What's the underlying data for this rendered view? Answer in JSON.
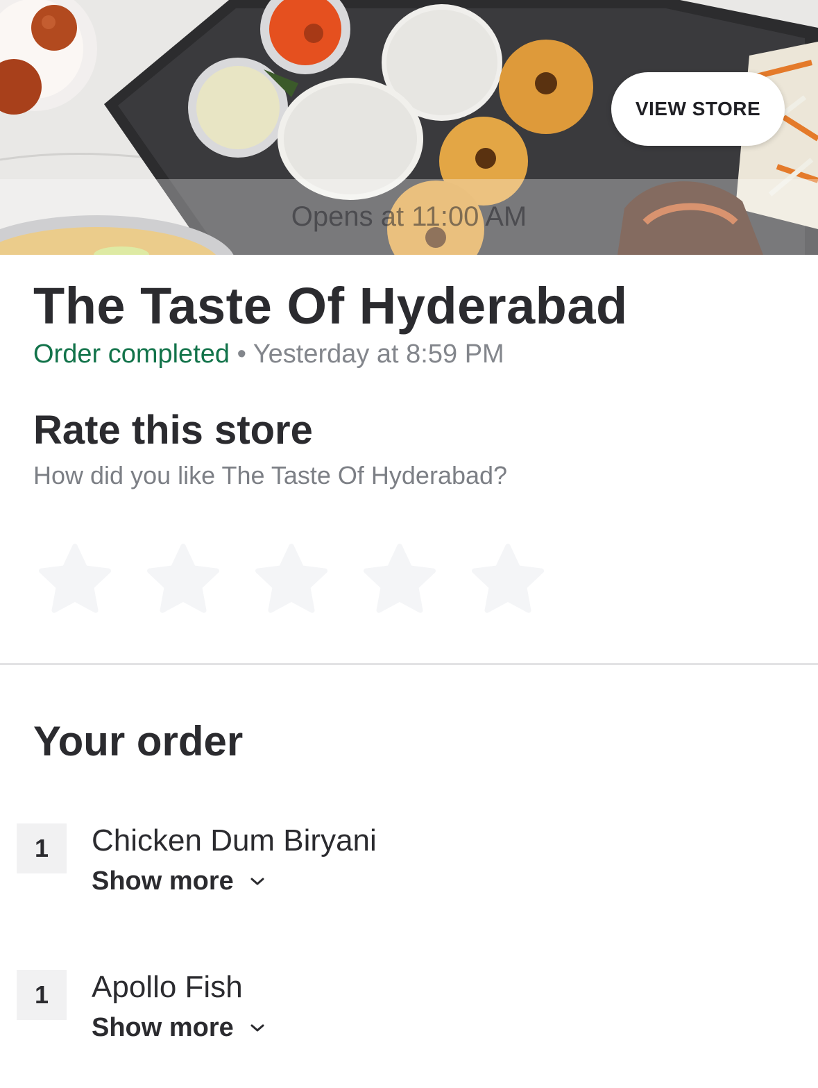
{
  "hero": {
    "status_text": "Opens at 11:00 AM",
    "view_store_label": "VIEW STORE"
  },
  "store": {
    "name": "The Taste Of Hyderabad",
    "order_status": "Order completed",
    "separator": "•",
    "order_time": "Yesterday at 8:59 PM"
  },
  "rating": {
    "title": "Rate this store",
    "prompt": "How did you like The Taste Of Hyderabad?",
    "max_stars": 5,
    "selected_stars": 0,
    "star_icon": "star-icon"
  },
  "order": {
    "heading": "Your order",
    "items": [
      {
        "quantity": "1",
        "name": "Chicken Dum Biryani",
        "show_more_label": "Show more",
        "expand_icon": "chevron-down-icon"
      },
      {
        "quantity": "1",
        "name": "Apollo Fish",
        "show_more_label": "Show more",
        "expand_icon": "chevron-down-icon"
      }
    ]
  },
  "colors": {
    "status_green": "#12734a",
    "muted_text": "#83868c",
    "primary_text": "#2b2b2f",
    "star_empty": "#f4f5f7",
    "divider": "#e2e2e4"
  }
}
